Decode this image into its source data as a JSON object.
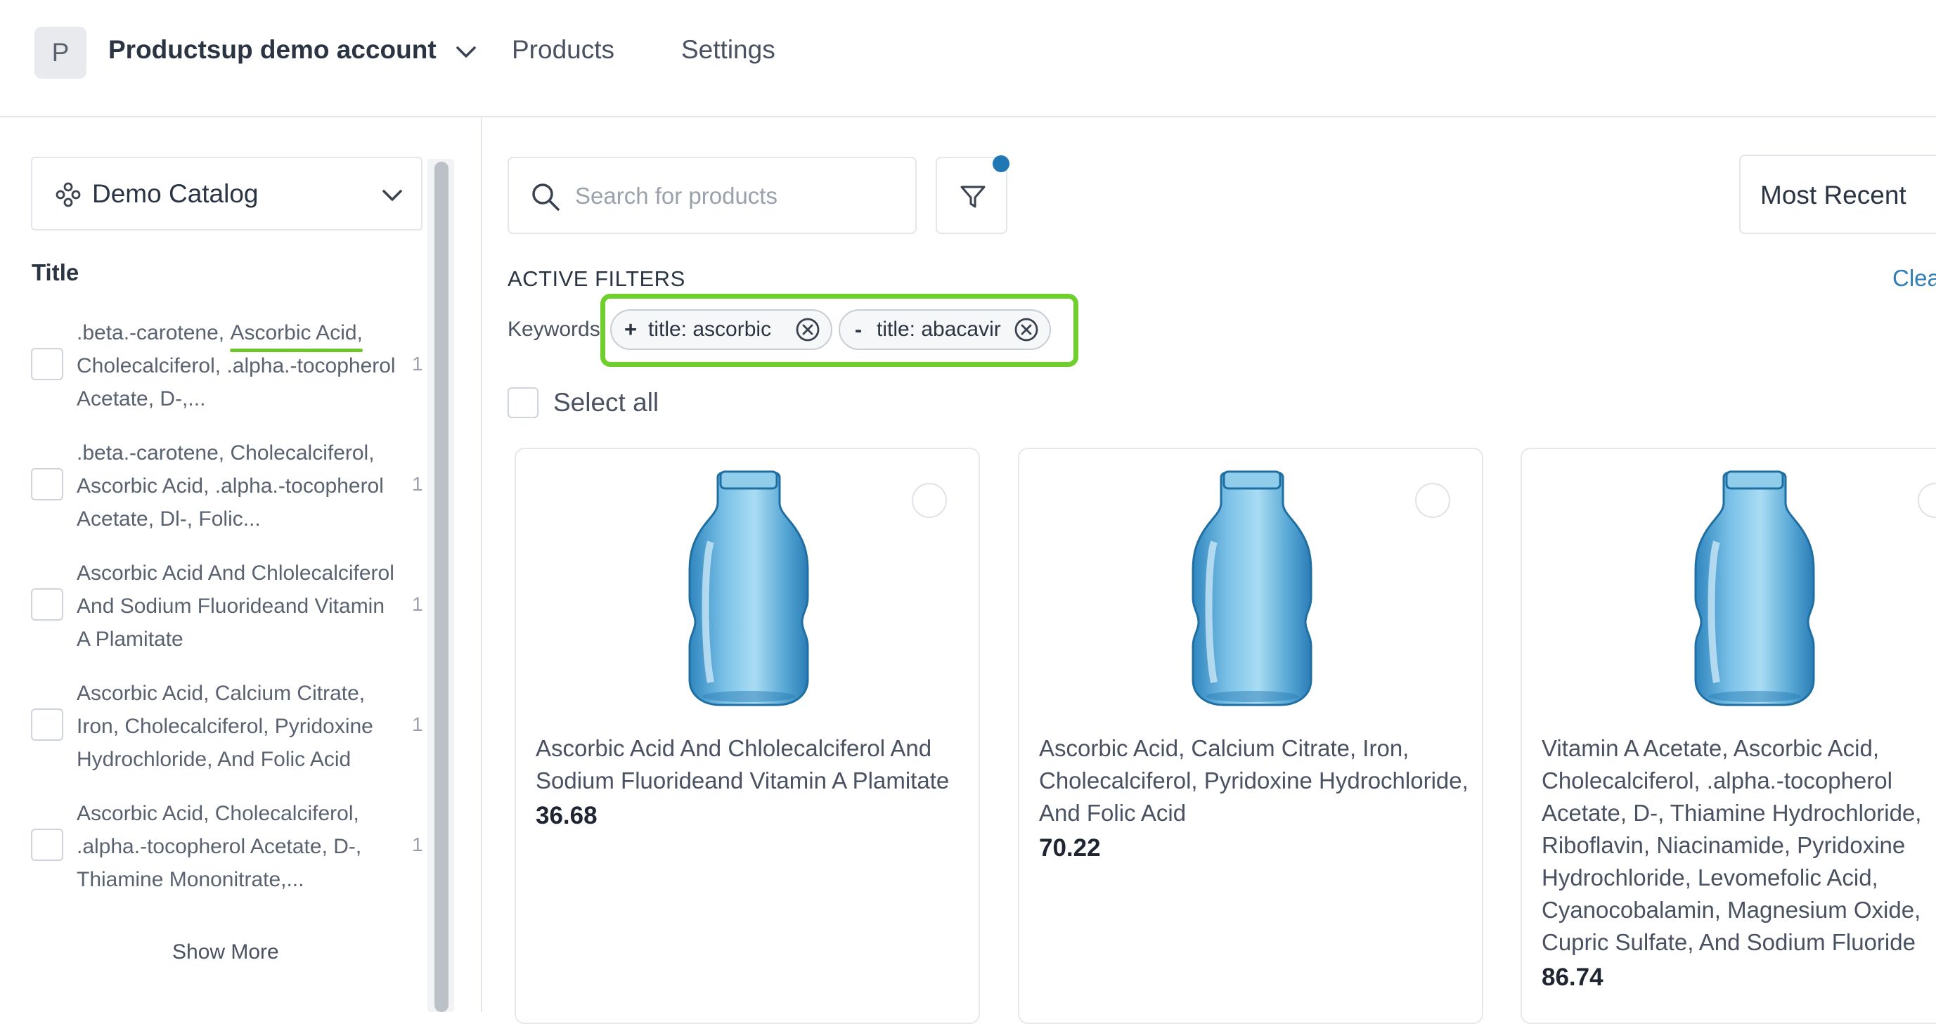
{
  "topbar": {
    "avatar_initial": "P",
    "account_name": "Productsup demo account",
    "nav": {
      "products": "Products",
      "settings": "Settings"
    }
  },
  "sidebar": {
    "catalog": "Demo Catalog",
    "facet_title": "Title",
    "facets": [
      {
        "text_before": ".beta.-carotene, ",
        "highlight": "Ascorbic Acid,",
        "text_after": " Cholecalciferol, .alpha.-tocopherol Acetate, D-,...",
        "count": "1"
      },
      {
        "text_before": ".beta.-carotene, Cholecalciferol, Ascorbic Acid, .alpha.-tocopherol Acetate, Dl-, Folic...",
        "highlight": "",
        "text_after": "",
        "count": "1"
      },
      {
        "text_before": "Ascorbic Acid And Chlolecalciferol And Sodium Fluorideand Vitamin A Plamitate",
        "highlight": "",
        "text_after": "",
        "count": "1"
      },
      {
        "text_before": "Ascorbic Acid, Calcium Citrate, Iron, Cholecalciferol, Pyridoxine Hydrochloride, And Folic Acid",
        "highlight": "",
        "text_after": "",
        "count": "1"
      },
      {
        "text_before": "Ascorbic Acid, Cholecalciferol, .alpha.-tocopherol Acetate, D-, Thiamine Mononitrate,...",
        "highlight": "",
        "text_after": "",
        "count": "1"
      }
    ],
    "show_more": "Show More"
  },
  "search": {
    "placeholder": "Search for products",
    "value": ""
  },
  "sort": {
    "label": "Most Recent"
  },
  "filters": {
    "heading": "ACTIVE FILTERS",
    "clear": "Clea",
    "keywords_label": "Keywords",
    "chips": [
      {
        "sign": "+",
        "text": "title: ascorbic"
      },
      {
        "sign": "-",
        "text": "title: abacavir"
      }
    ]
  },
  "select_all": "Select all",
  "products": [
    {
      "title": "Ascorbic Acid And Chlolecalciferol And Sodium Fluorideand Vitamin A Plamitate",
      "price": "36.68"
    },
    {
      "title": "Ascorbic Acid, Calcium Citrate, Iron, Cholecalciferol, Pyridoxine Hydrochloride, And Folic Acid",
      "price": "70.22"
    },
    {
      "title": "Vitamin A Acetate, Ascorbic Acid, Cholecalciferol, .alpha.-tocopherol Acetate, D-, Thiamine Hydrochloride, Riboflavin, Niacinamide, Pyridoxine Hydrochloride, Levomefolic Acid, Cyanocobalamin, Magnesium Oxide, Cupric Sulfate, And Sodium Fluoride",
      "price": "86.74"
    }
  ],
  "colors": {
    "accent_blue": "#1f78b4",
    "highlight_green": "#6fcf2d",
    "bottle_blue": "#5aa9d6"
  },
  "icons": [
    "chevron-down-icon",
    "catalog-icon",
    "search-icon",
    "filter-icon",
    "close-circle-icon",
    "bottle-image"
  ]
}
